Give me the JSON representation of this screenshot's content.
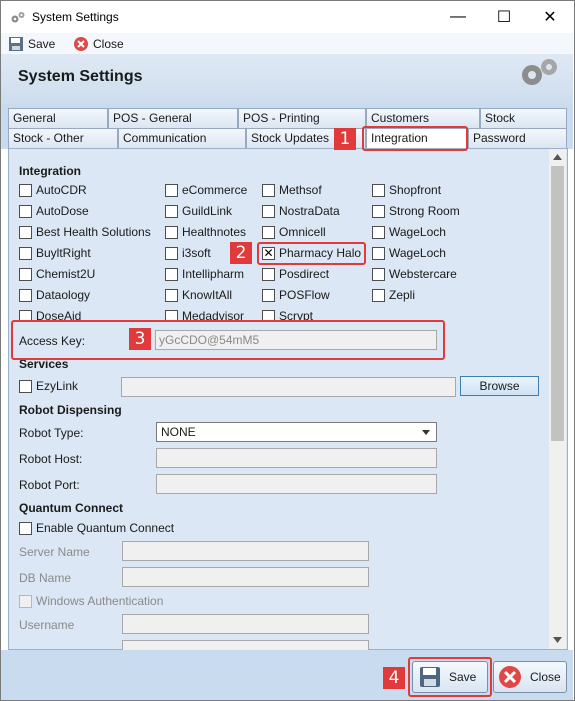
{
  "window": {
    "title": "System Settings",
    "minimize": "—",
    "maximize": "☐",
    "close": "✕"
  },
  "toolbar": {
    "save_label": "Save",
    "close_label": "Close"
  },
  "header": {
    "title": "System Settings"
  },
  "tabs": {
    "row1": [
      "General",
      "POS - General",
      "POS - Printing",
      "Customers",
      "Stock"
    ],
    "row2": [
      "Stock - Other",
      "Communication",
      "Stock Updates",
      "Integration",
      "Password"
    ],
    "active": "Integration"
  },
  "integration": {
    "heading": "Integration",
    "col1": [
      "AutoCDR",
      "AutoDose",
      "Best Health Solutions",
      "BuyltRight",
      "Chemist2U",
      "Dataology",
      "DoseAid"
    ],
    "col2": [
      "eCommerce",
      "GuildLink",
      "Healthnotes",
      "i3soft",
      "Intellipharm",
      "KnowItAll",
      "Medadvisor"
    ],
    "col3": [
      "Methsof",
      "NostraData",
      "Omnicell",
      "Pharmacy Halo",
      "Posdirect",
      "POSFlow",
      "Scrypt"
    ],
    "col4": [
      "Shopfront",
      "Strong Room",
      "WageLoch",
      "WageLoch",
      "Webstercare",
      "Zepli"
    ],
    "checked": "Pharmacy Halo",
    "access_key_label": "Access Key:",
    "access_key_value": "yGcCDO@54mM5"
  },
  "services": {
    "heading": "Services",
    "ezylink_label": "EzyLink",
    "browse_label": "Browse"
  },
  "robot": {
    "heading": "Robot Dispensing",
    "type_label": "Robot Type:",
    "type_value": "NONE",
    "host_label": "Robot Host:",
    "port_label": "Robot Port:"
  },
  "quantum": {
    "heading": "Quantum Connect",
    "enable_label": "Enable Quantum Connect",
    "server_label": "Server Name",
    "db_label": "DB Name",
    "windows_auth_label": "Windows Authentication",
    "username_label": "Username"
  },
  "bottom": {
    "save_label": "Save",
    "close_label": "Close"
  },
  "annotations": [
    "1",
    "2",
    "3",
    "4"
  ],
  "colors": {
    "annotation": "#e03a3a",
    "panel": "#dbe7f4",
    "tab_strip": "#c9dbee"
  }
}
